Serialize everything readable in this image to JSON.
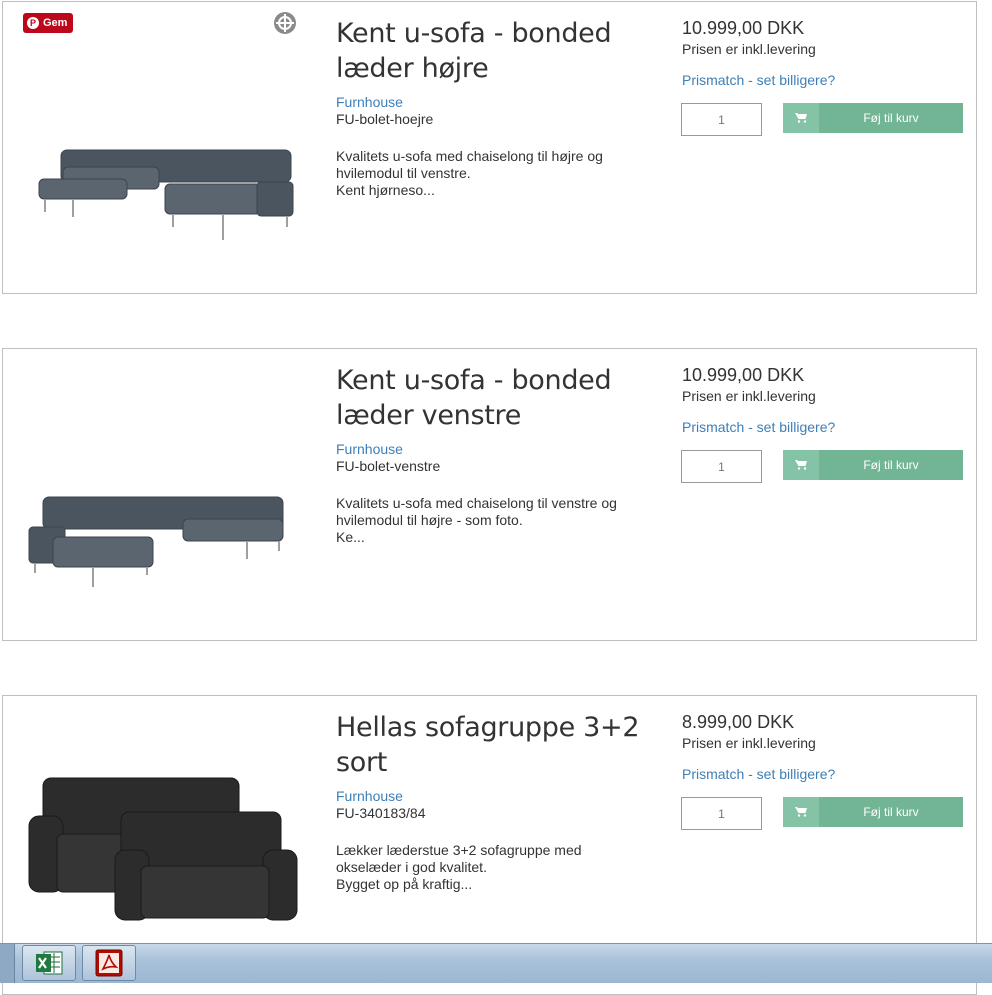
{
  "products": [
    {
      "title": "Kent u-sofa - bonded læder højre",
      "brand": "Furnhouse",
      "sku": "FU-bolet-hoejre",
      "desc_lines": [
        "Kvalitets u-sofa med chaiselong til højre og",
        "hvilemodul til venstre.",
        "Kent hjørneso..."
      ],
      "price": "10.999,00 DKK",
      "price_note": "Prisen er inkl.levering",
      "prismatch": "Prismatch - set billigere?",
      "qty": "1",
      "add_label": "Føj til kurv",
      "image": "u-sofa-right-grey",
      "pinterest_label": "Gem"
    },
    {
      "title": "Kent u-sofa - bonded læder venstre",
      "brand": "Furnhouse",
      "sku": "FU-bolet-venstre",
      "desc_lines": [
        "Kvalitets u-sofa med chaiselong til venstre og",
        "hvilemodul til højre - som foto.",
        "Ke..."
      ],
      "price": "10.999,00 DKK",
      "price_note": "Prisen er inkl.levering",
      "prismatch": "Prismatch - set billigere?",
      "qty": "1",
      "add_label": "Føj til kurv",
      "image": "u-sofa-left-grey"
    },
    {
      "title": "Hellas sofagruppe 3+2 sort",
      "brand": "Furnhouse",
      "sku": "FU-340183/84",
      "desc_lines": [
        "Lækker læderstue 3+2 sofagruppe med",
        "okselæder i god kvalitet.",
        "Bygget op på kraftig..."
      ],
      "price": "8.999,00 DKK",
      "price_note": "Prisen er inkl.levering",
      "prismatch": "Prismatch - set billigere?",
      "qty": "1",
      "add_label": "Føj til kurv",
      "image": "sofa-set-black"
    }
  ],
  "taskbar": {
    "apps": [
      "excel-icon",
      "acrobat-icon"
    ]
  },
  "colors": {
    "link": "#3d7fb8",
    "cart_button": "#72b594",
    "pinterest": "#bd081c"
  }
}
